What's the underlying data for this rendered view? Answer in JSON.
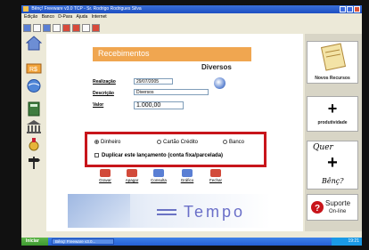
{
  "window": {
    "title": "Bênç! Freeware v3.0 TCP - Sr. Rodrigo Rodrigues Silva"
  },
  "menu": [
    "Edição",
    "Banco",
    "D-Para",
    "Ajuda",
    "Internet"
  ],
  "form": {
    "header": "Recebimentos",
    "category": "Diversos",
    "fields": {
      "realizacao_label": "Realização",
      "realizacao_value": "29/07/2005",
      "descricao_label": "Descrição",
      "descricao_value": "Diversos",
      "valor_label": "Valor",
      "valor_value": "1.000,00"
    },
    "payment": {
      "dinheiro": "Dinheiro",
      "cartao": "Cartão Crédito",
      "banco": "Banco",
      "selected": "Dinheiro"
    },
    "duplicate_label": "Duplicar este lançamento (conta fixa/parcelada)",
    "buttons": [
      "Gravar",
      "Apagar",
      "Consulta",
      "Gráfico",
      "Fechar"
    ]
  },
  "banner": {
    "text": "Tempo"
  },
  "rightpanel": {
    "novos_recursos": "Novos Recursos",
    "produtividade": "produtividade",
    "quer_line1": "Quer",
    "quer_line2": "Bênç?",
    "suporte_line1": "Suporte",
    "suporte_line2": "On-line"
  },
  "taskbar": {
    "start": "Iniciar",
    "task": "Bênç! Freeware v3.0...",
    "clock": "19:21"
  },
  "colors": {
    "accent_orange": "#f0a650",
    "highlight_red": "#c8151b",
    "banner_text": "#6a6fc8"
  }
}
